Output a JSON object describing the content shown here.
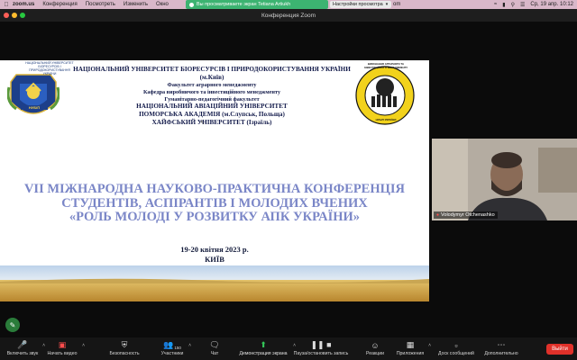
{
  "menubar": {
    "app": "zoom.us",
    "items": [
      "Конференция",
      "Посмотреть",
      "Изменить",
      "Окно"
    ],
    "sharing_pill": "Вы просматриваете экран Tetiana Artiukh",
    "sharing_settings": "Настройки просмотра",
    "zoom_fragment": "om",
    "clock": "Ср, 19 апр.  10:12"
  },
  "window": {
    "title": "Конференция Zoom"
  },
  "slide": {
    "crest_caption": "НАЦІОНАЛЬНИЙ УНІВЕРСИТЕТ БІОРЕСУРСІВ І ПРИРОДОКОРИСТУВАННЯ УКРАЇНИ",
    "crest_ribbon": "НУБіП",
    "emblem_text": "ВИКОНАННЯ АГРАРНОГО ТА ІНВЕСТИЦІЙНОГО МЕНЕДЖМЕНТУ",
    "emblem_bottom": "НУБіП УКРАЇНИ",
    "header": [
      "НАЦІОНАЛЬНИЙ УНІВЕРСИТЕТ БІОРЕСУРСІВ І ПРИРОДОКОРИСТУВАННЯ УКРАЇНИ (м.Київ)",
      "Факультет аграрного менеджменту",
      "Кафедра виробничого та інвестиційного менеджменту",
      "Гуманітарно-педагогічний факультет",
      "НАЦІОНАЛЬНИЙ АВІАЦІЙНИЙ УНІВЕРСИТЕТ",
      "ПОМОРСЬКА АКАДЕМІЯ (м.Слупськ, Польща)",
      "ХАЙФСЬКИЙ УНІВЕРСИТЕТ  (Ізраїль)"
    ],
    "title": [
      "VII МІЖНАРОДНА НАУКОВО-ПРАКТИЧНА КОНФЕРЕНЦІЯ",
      "СТУДЕНТІВ, АСПІРАНТІВ І МОЛОДИХ ВЧЕНИХ",
      "«РОЛЬ МОЛОДІ У РОЗВИТКУ АПК УКРАЇНИ»"
    ],
    "date": "19-20 квітня 2023 р.",
    "city": "КИЇВ"
  },
  "video": {
    "participant_name": "Volodymyr Otchenashko"
  },
  "toolbar": {
    "mute": "Включить звук",
    "video": "Начать видео",
    "security": "Безопасность",
    "participants": "Участники",
    "participants_count": "150",
    "chat": "Чат",
    "share": "Демонстрация экрана",
    "record": "Пауза/остановить запись",
    "reactions": "Реакции",
    "apps": "Приложения",
    "whiteboards": "Доск сообщений",
    "more": "Дополнительно",
    "end": "Выйти"
  },
  "colors": {
    "menubar_bg": "#d9b7c9",
    "share_green": "#3cb371",
    "end_red": "#e0312a",
    "title_blue": "#7a86c7"
  }
}
